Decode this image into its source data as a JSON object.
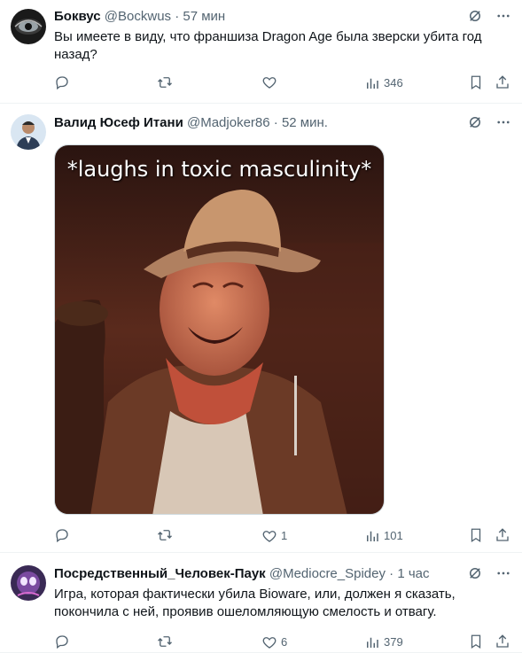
{
  "tweets": [
    {
      "name": "Боквус",
      "handle": "@Bockwus",
      "dot": "·",
      "time": "57 мин",
      "text": "Вы имеете в виду, что франшиза Dragon Age была зверски убита год назад?",
      "replies": "",
      "retweets": "",
      "likes": "",
      "views": "346"
    },
    {
      "name": "Валид Юсеф Итани",
      "handle": "@Madjoker86",
      "dot": "·",
      "time": "52 мин.",
      "media_caption": "*laughs in toxic masculinity*",
      "replies": "",
      "retweets": "",
      "likes": "1",
      "views": "101"
    },
    {
      "name": "Посредственный_Человек-Паук",
      "handle": "@Mediocre_Spidey",
      "dot": "·",
      "time": "1 час",
      "text": "Игра, которая фактически убила Bioware, или, должен я сказать, покончила с ней, проявив ошеломляющую смелость и отвагу.",
      "replies": "",
      "retweets": "",
      "likes": "6",
      "views": "379"
    }
  ],
  "icons": [
    "reply-icon",
    "retweet-icon",
    "like-icon",
    "views-icon",
    "bookmark-icon",
    "share-icon",
    "grok-icon",
    "more-icon"
  ],
  "colors": {
    "text": "#0f1419",
    "secondary": "#536471",
    "border": "#eff3f4"
  }
}
